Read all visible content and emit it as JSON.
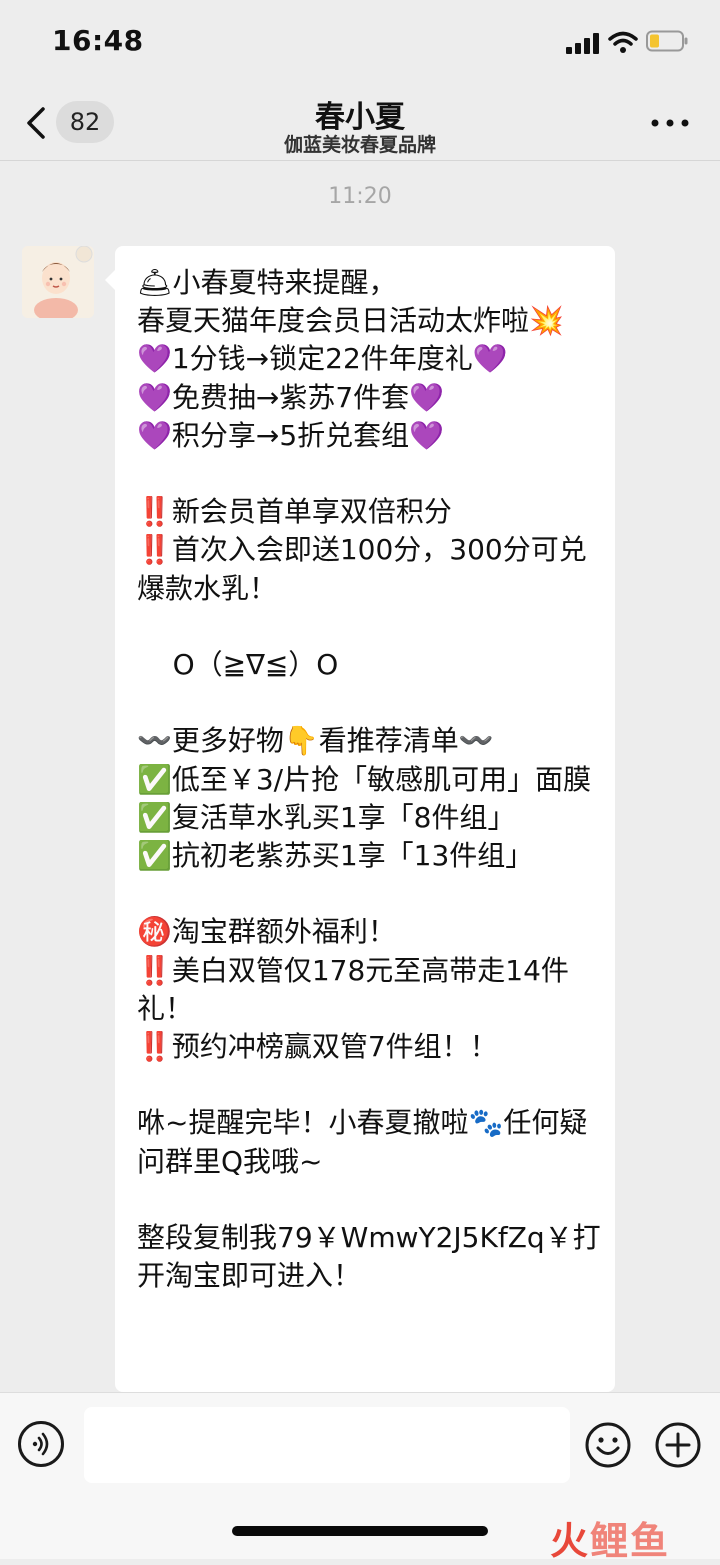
{
  "status_bar": {
    "time": "16:48"
  },
  "nav": {
    "unread_count": "82",
    "title": "春小夏",
    "subtitle": "伽蓝美妆春夏品牌"
  },
  "chat": {
    "timestamp": "11:20",
    "message": "🛎小春夏特来提醒，\n春夏天猫年度会员日活动太炸啦💥\n💜1分钱→锁定22件年度礼💜\n💜免费抽→紫苏7件套💜\n💜积分享→5折兑套组💜\n\n‼️新会员首单享双倍积分\n‼️首次入会即送100分，300分可兑爆款水乳！\n\n    O（≧∇≦）O\n\n〰️更多好物👇看推荐清单〰️\n✅低至￥3/片抢「敏感肌可用」面膜\n✅复活草水乳买1享「8件组」\n✅抗初老紫苏买1享「13件组」\n\n㊙️淘宝群额外福利！\n‼️美白双管仅178元至高带走14件礼！\n‼️预约冲榜赢双管7件组！！\n\n咻~提醒完毕！小春夏撤啦🐾任何疑问群里Q我哦~\n\n整段复制我79￥WmwY2J5KfZq￥打开淘宝即可进入！"
  },
  "watermark": {
    "part1": "火",
    "part2": "鲤鱼"
  },
  "colors": {
    "background": "#ededed",
    "bubble": "#ffffff",
    "watermark": "#e8483a"
  }
}
